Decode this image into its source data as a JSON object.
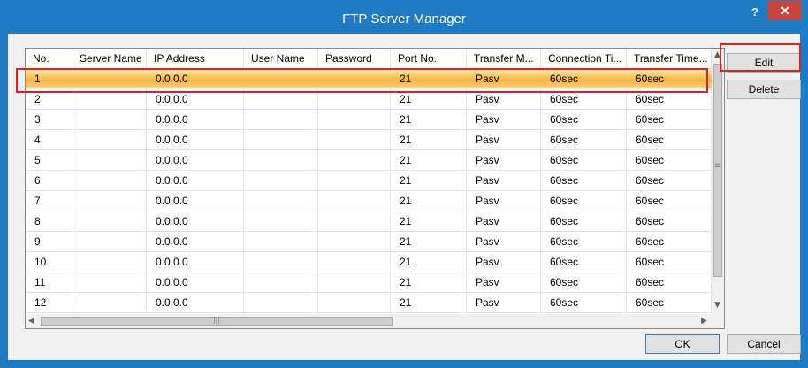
{
  "window": {
    "title": "FTP Server Manager",
    "help_label": "?",
    "close_label": "✕"
  },
  "table": {
    "columns": [
      "No.",
      "Server Name",
      "IP Address",
      "User Name",
      "Password",
      "Port No.",
      "Transfer M...",
      "Connection Ti...",
      "Transfer Time..."
    ],
    "rows": [
      [
        "1",
        "",
        "0.0.0.0",
        "",
        "",
        "21",
        "Pasv",
        "60sec",
        "60sec"
      ],
      [
        "2",
        "",
        "0.0.0.0",
        "",
        "",
        "21",
        "Pasv",
        "60sec",
        "60sec"
      ],
      [
        "3",
        "",
        "0.0.0.0",
        "",
        "",
        "21",
        "Pasv",
        "60sec",
        "60sec"
      ],
      [
        "4",
        "",
        "0.0.0.0",
        "",
        "",
        "21",
        "Pasv",
        "60sec",
        "60sec"
      ],
      [
        "5",
        "",
        "0.0.0.0",
        "",
        "",
        "21",
        "Pasv",
        "60sec",
        "60sec"
      ],
      [
        "6",
        "",
        "0.0.0.0",
        "",
        "",
        "21",
        "Pasv",
        "60sec",
        "60sec"
      ],
      [
        "7",
        "",
        "0.0.0.0",
        "",
        "",
        "21",
        "Pasv",
        "60sec",
        "60sec"
      ],
      [
        "8",
        "",
        "0.0.0.0",
        "",
        "",
        "21",
        "Pasv",
        "60sec",
        "60sec"
      ],
      [
        "9",
        "",
        "0.0.0.0",
        "",
        "",
        "21",
        "Pasv",
        "60sec",
        "60sec"
      ],
      [
        "10",
        "",
        "0.0.0.0",
        "",
        "",
        "21",
        "Pasv",
        "60sec",
        "60sec"
      ],
      [
        "11",
        "",
        "0.0.0.0",
        "",
        "",
        "21",
        "Pasv",
        "60sec",
        "60sec"
      ],
      [
        "12",
        "",
        "0.0.0.0",
        "",
        "",
        "21",
        "Pasv",
        "60sec",
        "60sec"
      ]
    ],
    "selected_row": 0
  },
  "buttons": {
    "edit": "Edit",
    "delete": "Delete",
    "ok": "OK",
    "cancel": "Cancel"
  },
  "icons": {
    "scroll_up": "▲",
    "scroll_down": "▼",
    "scroll_left": "◀",
    "scroll_right": "▶",
    "grip_v": "≡",
    "grip_h": "|||"
  },
  "colors": {
    "titlebar": "#1e7bc4",
    "selection": "#f6b43e",
    "highlight": "#e02020",
    "close": "#c9443a"
  }
}
